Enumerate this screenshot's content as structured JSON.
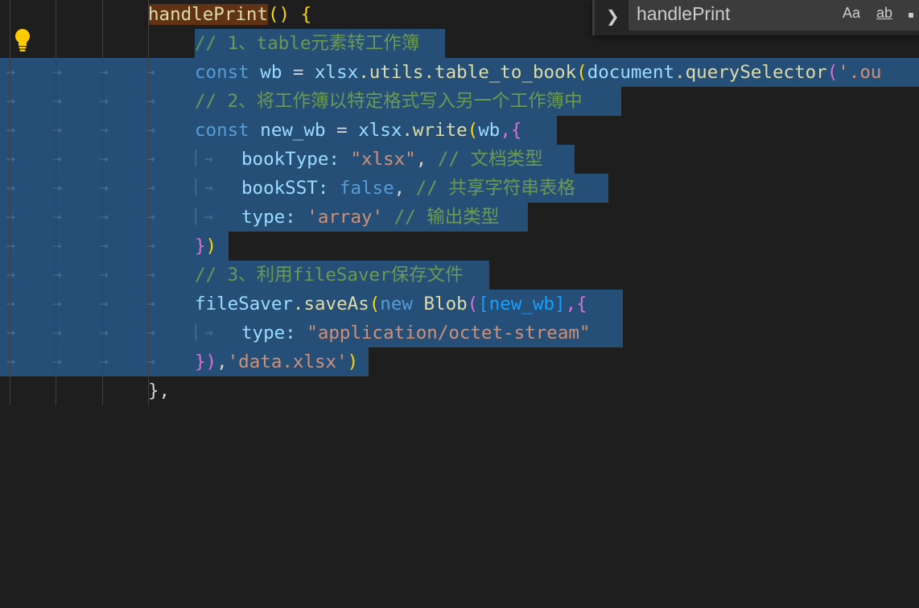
{
  "code": {
    "line1": {
      "name": "handlePrint",
      "rest": "() {"
    },
    "line2": {
      "comment": "// 1、table元素转工作簿"
    },
    "line3": {
      "kw": "const",
      "var": "wb",
      "op": " = ",
      "obj": "xlsx",
      "fn": ".utils.table_to_book",
      "open": "(",
      "arg": "document",
      "call": ".querySelector",
      "open2": "(",
      "str": "'.ou"
    },
    "line4": {
      "comment": "// 2、将工作簿以特定格式写入另一个工作簿中"
    },
    "line5": {
      "kw": "const",
      "var": "new_wb",
      "op": " = ",
      "obj": "xlsx",
      "fn": ".write",
      "open": "(",
      "arg": "wb",
      "brace": ",{"
    },
    "line6": {
      "key": "bookType:",
      "val": "\"xlsx\"",
      "comma": ",",
      "comment": "// 文档类型"
    },
    "line7": {
      "key": "bookSST:",
      "val": "false",
      "comma": ",",
      "comment": "// 共享字符串表格"
    },
    "line8": {
      "key": "type:",
      "val": "'array'",
      "comment": "// 输出类型"
    },
    "line9": {
      "brace": "}",
      "paren": ")"
    },
    "line10": {
      "comment": "// 3、利用fileSaver保存文件"
    },
    "line11": {
      "obj": "fileSaver",
      "fn": ".saveAs",
      "open": "(",
      "kw": "new",
      "cls": "Blob",
      "open2": "(",
      "arr": "[new_wb]",
      "brace": ",{"
    },
    "line12": {
      "key": "type:",
      "val": "\"application/octet-stream\""
    },
    "line13": {
      "brace": "}",
      "paren": ")",
      "comma": ",",
      "str": "'data.xlsx'",
      "close": ")"
    },
    "line14": {
      "text": "},"
    }
  },
  "whitespace": {
    "arrow": "→",
    "guide": "│"
  },
  "find_widget": {
    "toggle_icon": "chevron-right-icon",
    "toggle_glyph": "❯",
    "search_term": "handlePrint",
    "match_case": "Aa",
    "match_word": "ab"
  },
  "colors": {
    "background": "#1e1e1e",
    "selection": "#264f78",
    "find_match": "#613214",
    "lightbulb": "#ffcc00"
  }
}
